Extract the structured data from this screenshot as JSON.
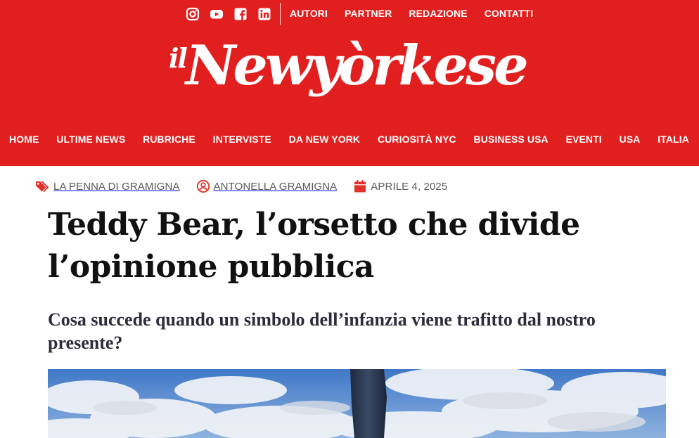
{
  "colors": {
    "brand_red": "#e21f1f",
    "meta_red": "#e0312b"
  },
  "topbar": {
    "social_icons": [
      "instagram-icon",
      "youtube-icon",
      "facebook-icon",
      "linkedin-icon"
    ],
    "links": [
      "AUTORI",
      "PARTNER",
      "REDAZIONE",
      "CONTATTI"
    ]
  },
  "logo": {
    "prefix": "il",
    "name": "Newyòrkese"
  },
  "nav": {
    "items": [
      "HOME",
      "ULTIME NEWS",
      "RUBRICHE",
      "INTERVISTE",
      "DA NEW YORK",
      "CURIOSITÀ NYC",
      "BUSINESS USA",
      "EVENTI",
      "USA",
      "ITALIA"
    ]
  },
  "article": {
    "category": "LA PENNA DI GRAMIGNA",
    "author": "ANTONELLA GRAMIGNA",
    "date": "APRILE 4, 2025",
    "title": "Teddy Bear, l’orsetto che divide l’opinione pubblica",
    "subtitle": "Cosa succede quando un simbolo dell’infanzia viene trafitto dal nostro presente?"
  }
}
